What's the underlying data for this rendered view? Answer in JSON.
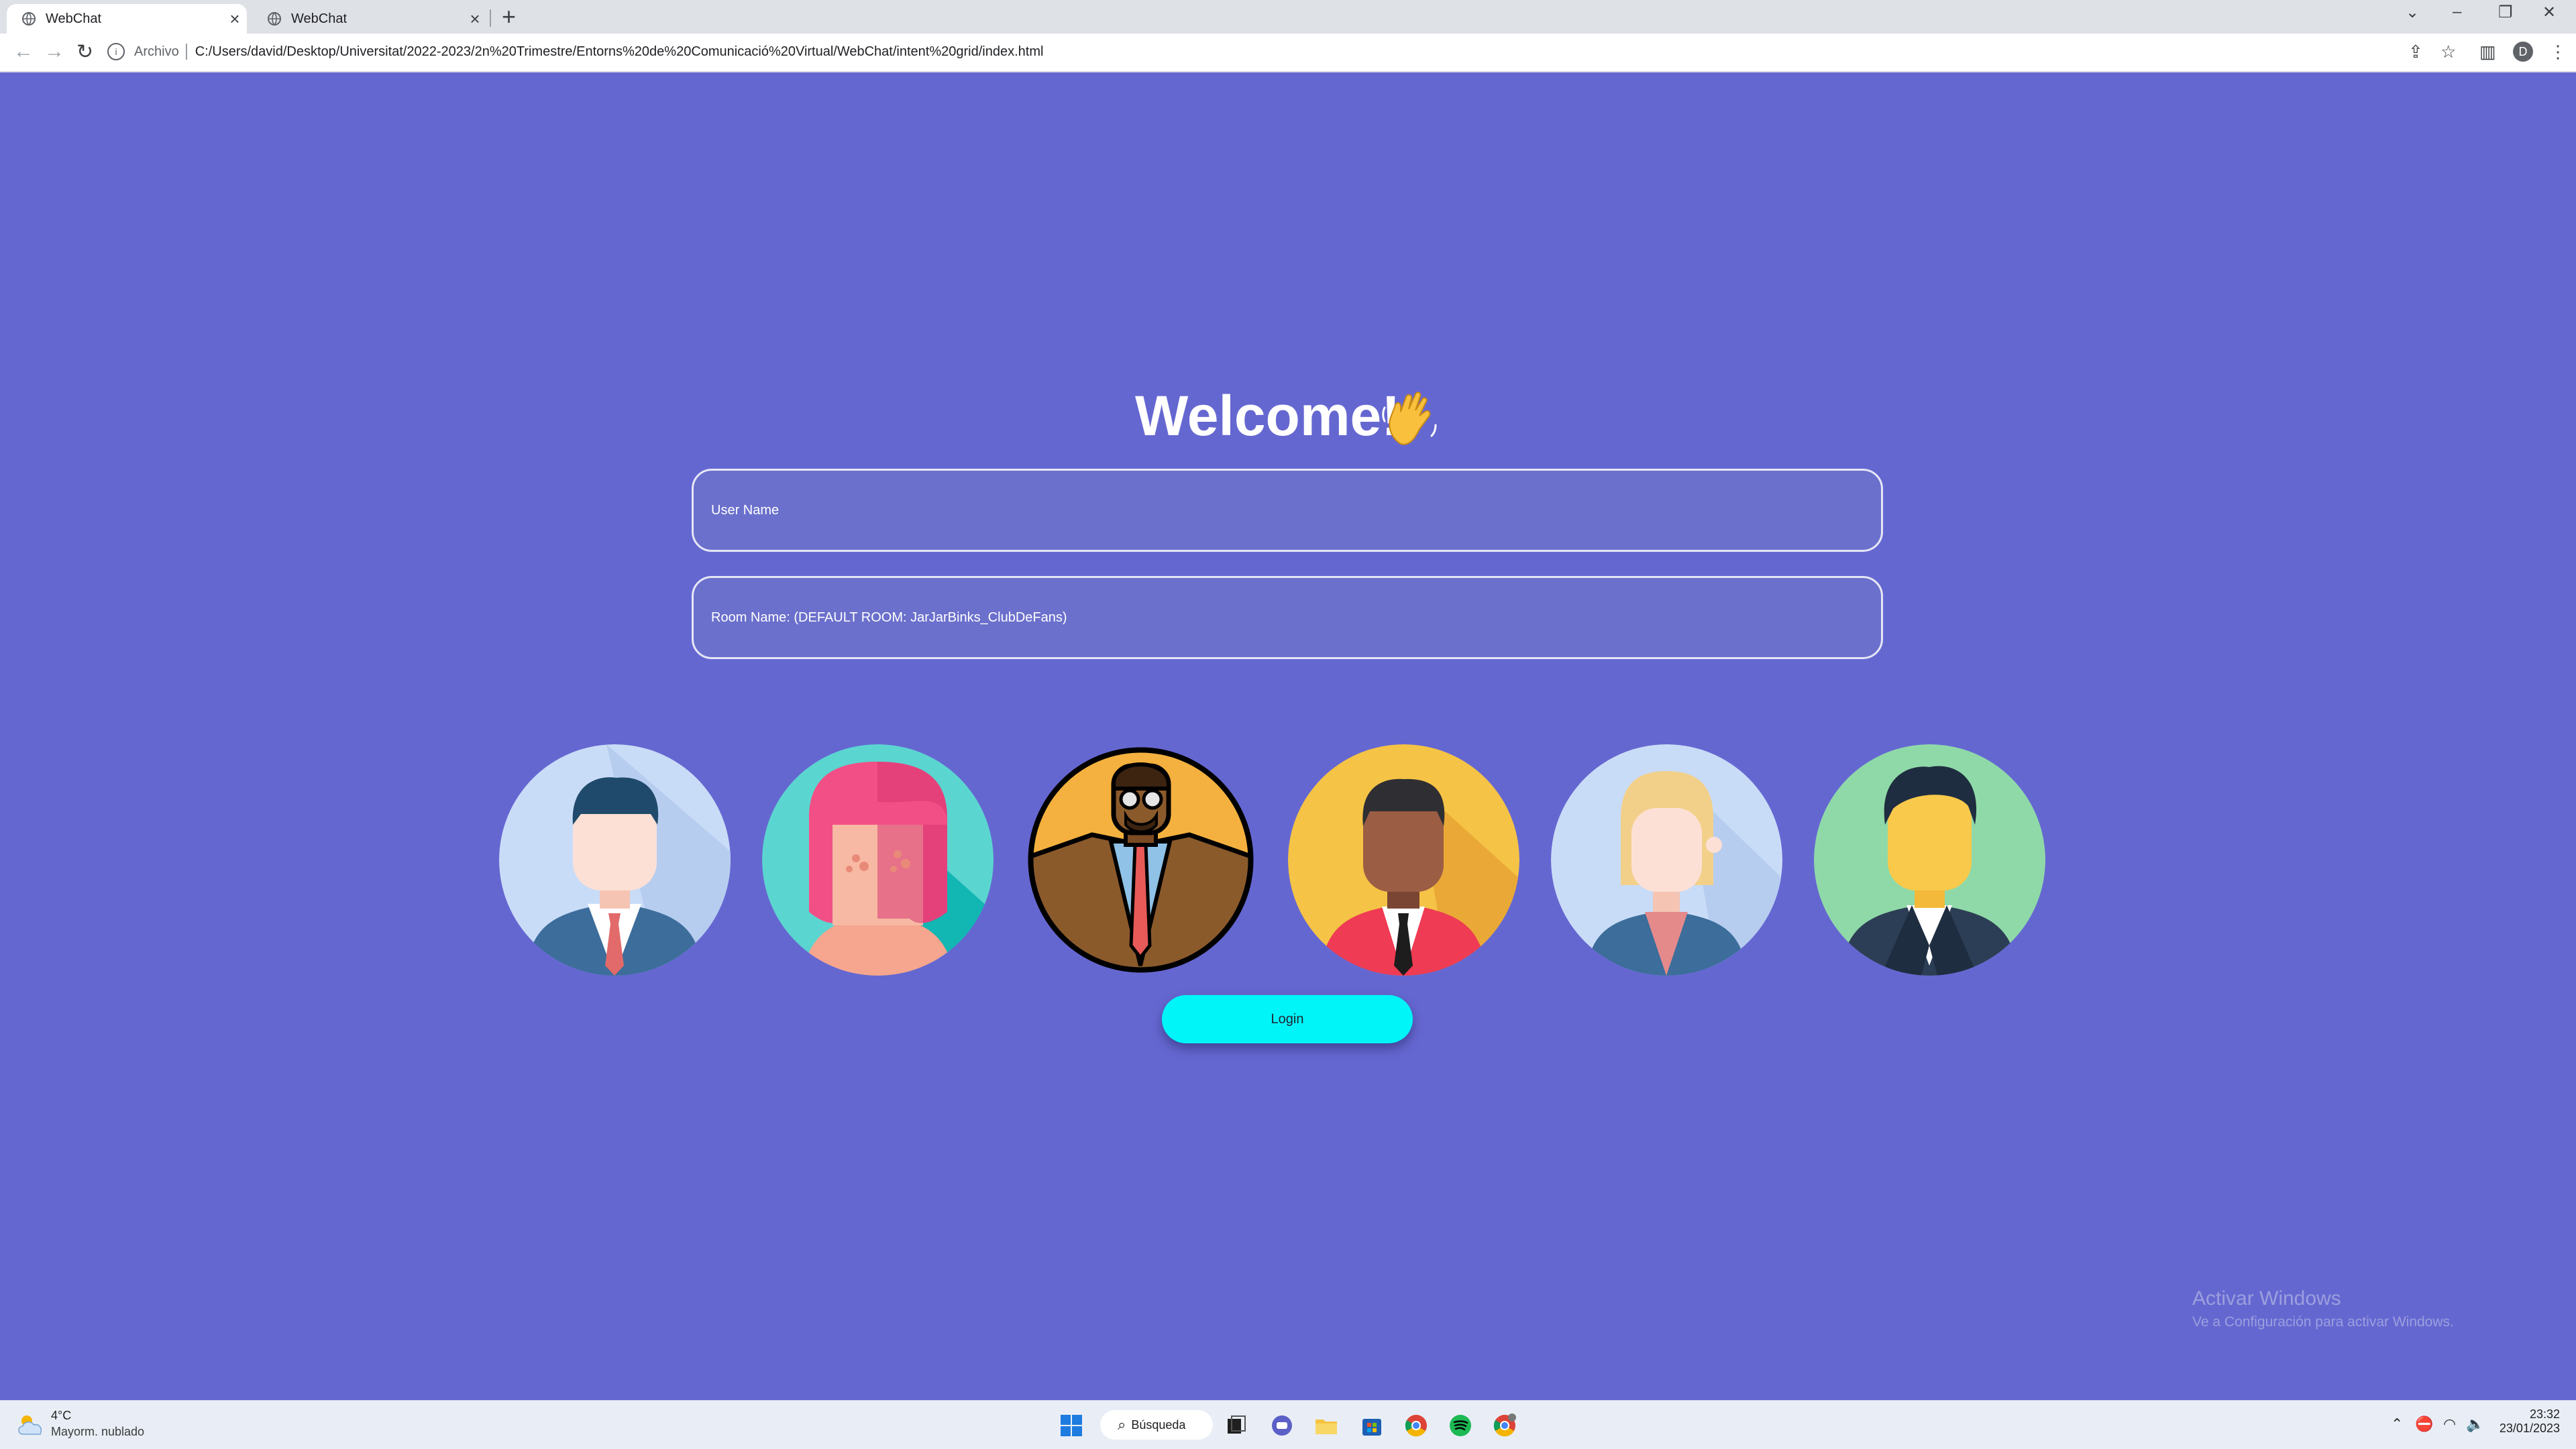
{
  "browser": {
    "tabs": [
      {
        "label": "WebChat",
        "active": true
      },
      {
        "label": "WebChat",
        "active": false
      }
    ],
    "new_tab_icon": "plus-icon",
    "address_prefix": "Archivo",
    "url": "C:/Users/david/Desktop/Universitat/2022-2023/2n%20Trimestre/Entorns%20de%20Comunicació%20Virtual/WebChat/intent%20grid/index.html",
    "profile_initial": "D"
  },
  "page": {
    "title": "Welcome!",
    "wave_icon": "waving-hand-icon",
    "username_placeholder": "User Name",
    "room_placeholder": "Room Name: (DEFAULT ROOM: JarJarBinks_ClubDeFans)",
    "login_label": "Login",
    "background_color": "#6567d1",
    "login_color": "#00f5f9",
    "avatars": [
      {
        "name": "man-blue-suit-avatar",
        "selected": false
      },
      {
        "name": "woman-pink-hair-avatar",
        "selected": false
      },
      {
        "name": "man-glasses-brown-suit-avatar",
        "selected": true
      },
      {
        "name": "man-red-suit-avatar",
        "selected": false
      },
      {
        "name": "woman-blonde-avatar",
        "selected": false
      },
      {
        "name": "man-dark-suit-avatar",
        "selected": false
      }
    ]
  },
  "watermark": {
    "line1": "Activar Windows",
    "line2": "Ve a Configuración para activar Windows."
  },
  "taskbar": {
    "temperature": "4°C",
    "condition": "Mayorm. nublado",
    "search_label": "Búsqueda",
    "time": "23:32",
    "date": "23/01/2023"
  }
}
